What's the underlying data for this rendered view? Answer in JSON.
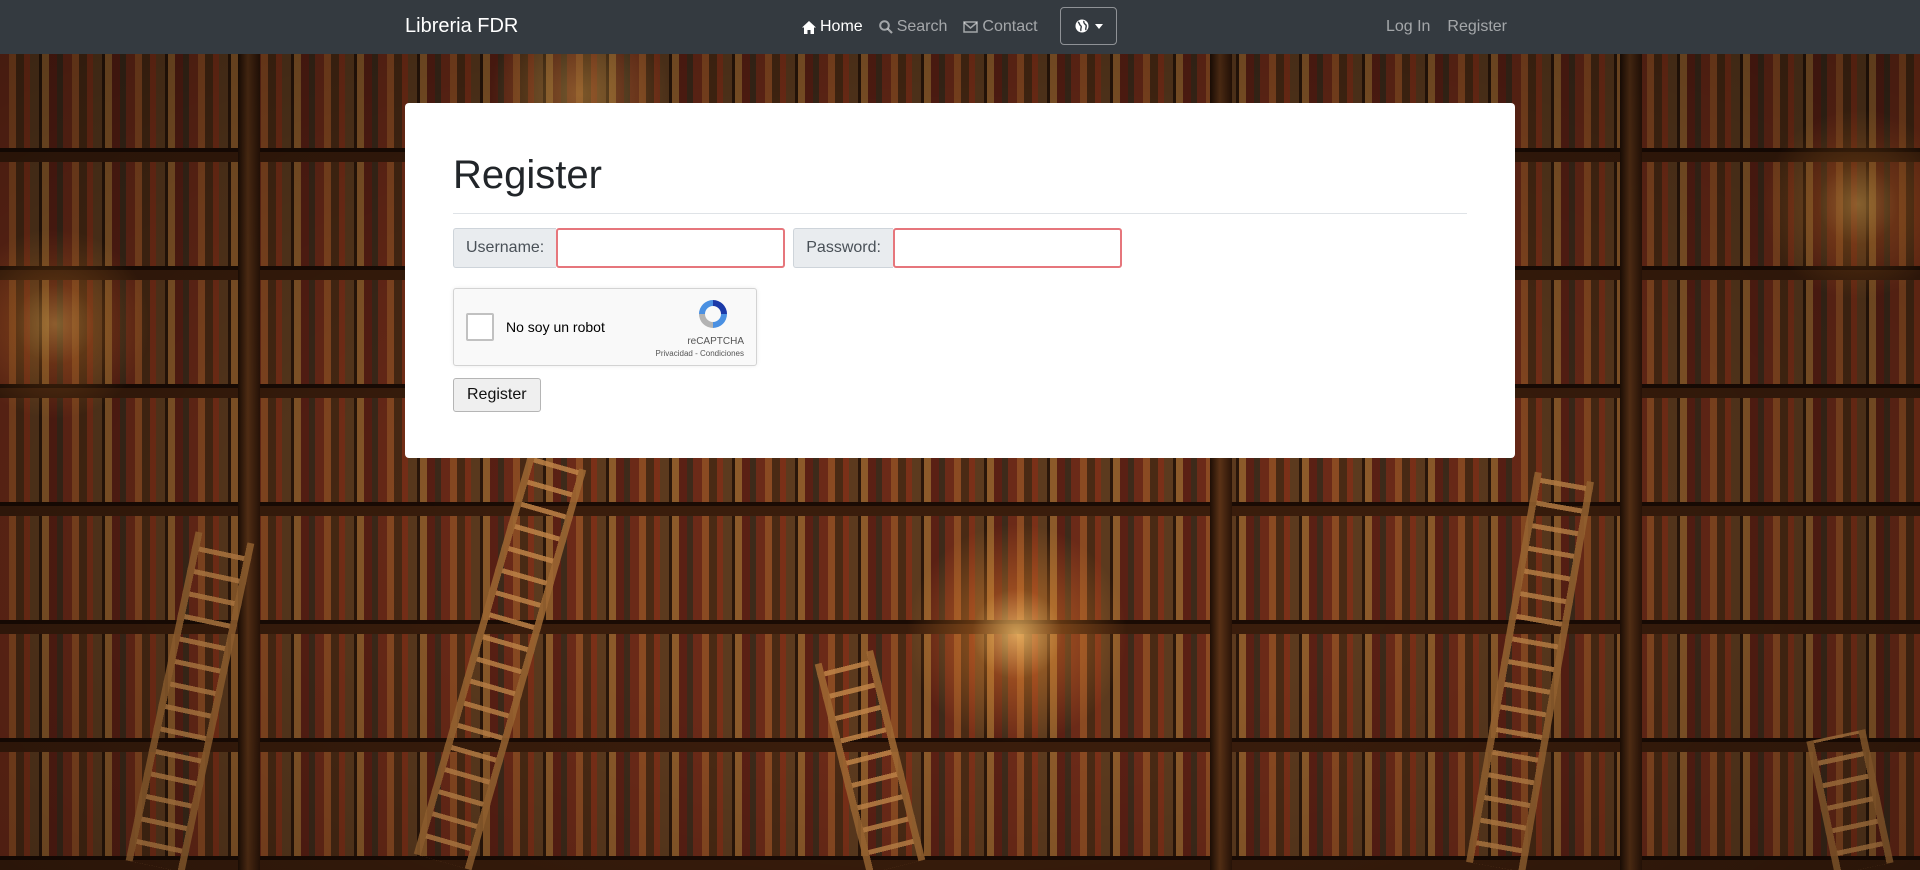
{
  "navbar": {
    "brand": "Libreria FDR",
    "links": [
      {
        "label": "Home",
        "icon": "home-icon",
        "active": true
      },
      {
        "label": "Search",
        "icon": "search-icon",
        "active": false
      },
      {
        "label": "Contact",
        "icon": "envelope-icon",
        "active": false
      }
    ],
    "language_icon": "globe-icon",
    "login_label": "Log In",
    "register_label": "Register"
  },
  "form": {
    "title": "Register",
    "username_label": "Username:",
    "username_value": "",
    "password_label": "Password:",
    "password_value": "",
    "captcha": {
      "label": "No soy un robot",
      "brand": "reCAPTCHA",
      "privacy": "Privacidad",
      "terms": "Condiciones"
    },
    "submit_label": "Register"
  },
  "colors": {
    "navbar_bg": "#343a40",
    "invalid_border": "#e6767c",
    "addon_bg": "#e9ecef"
  }
}
